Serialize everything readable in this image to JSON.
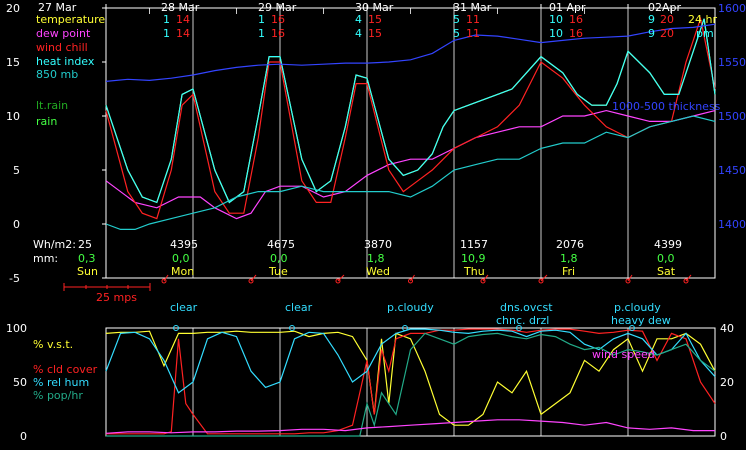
{
  "colors": {
    "temperature": "#ffff33",
    "dew_point": "#ff44ff",
    "wind_chill": "#ff2222",
    "heat_index": "#33ffff",
    "mb850": "#22cccc",
    "thickness": "#3344ff",
    "lt_rain": "#22aa22",
    "rain": "#44ff44",
    "vst": "#ffff33",
    "cld_cover": "#ff2222",
    "rel_hum": "#33ddff",
    "pop_hr": "#22aa88",
    "wind_speed": "#ff44ff",
    "grid": "#ffffff",
    "label_white": "#ffffff"
  },
  "dates": [
    "27 Mar",
    "28 Mar",
    "29 Mar",
    "30 Mar",
    "31 Mar",
    "01 Apr",
    "02Apr"
  ],
  "hour_labels": {
    "h24": "24 hr",
    "pm": "pm"
  },
  "daily_temps": [
    {
      "a": "1",
      "b": "14",
      "c": "1",
      "d": "14"
    },
    {
      "a": "1",
      "b": "16",
      "c": "1",
      "d": "16"
    },
    {
      "a": "4",
      "b": "15",
      "c": "4",
      "d": "15"
    },
    {
      "a": "5",
      "b": "11",
      "c": "5",
      "d": "11"
    },
    {
      "a": "10",
      "b": "16",
      "c": "10",
      "d": "16"
    },
    {
      "a": "9",
      "b": "20",
      "c": "9",
      "d": "20"
    }
  ],
  "legend_top": {
    "temperature": "temperature",
    "dew_point": "dew point",
    "wind_chill": "wind chill",
    "heat_index": "heat index",
    "mb850": "850 mb",
    "lt_rain": "lt.rain",
    "rain": "rain",
    "thickness": "1000-500 thickness"
  },
  "daily": {
    "wh_label": "Wh/m2:",
    "mm_label": "mm:",
    "first_wh": "25",
    "first_mm": "0,3",
    "first_day": "Sun",
    "days": [
      {
        "wh": "4395",
        "mm": "0,0",
        "day": "Mon"
      },
      {
        "wh": "4675",
        "mm": "0,0",
        "day": "Tue"
      },
      {
        "wh": "3870",
        "mm": "1,8",
        "day": "Wed"
      },
      {
        "wh": "1157",
        "mm": "10,9",
        "day": "Thu"
      },
      {
        "wh": "2076",
        "mm": "1,8",
        "day": "Fri"
      },
      {
        "wh": "4399",
        "mm": "0,0",
        "day": "Sat"
      }
    ]
  },
  "wind_scale": "25 mps",
  "sky": [
    {
      "l1": "clear",
      "l2": ""
    },
    {
      "l1": "clear",
      "l2": ""
    },
    {
      "l1": "p.cloudy",
      "l2": ""
    },
    {
      "l1": "dns.ovcst",
      "l2": "chnc. drzl"
    },
    {
      "l1": "p.cloudy",
      "l2": "heavy dew"
    }
  ],
  "legend_bottom": {
    "vst": "% v.s.t.",
    "cld_cover": "% cld cover",
    "rel_hum": "% rel hum",
    "pop_hr": "% pop/hr",
    "wind_speed": "wind speed"
  },
  "chart_data": [
    {
      "type": "line",
      "x_unit": "hours from 27 Mar 00:00",
      "xlim": [
        0,
        168
      ],
      "ylim_left": [
        -5,
        20
      ],
      "yticks_left": [
        "20",
        "15",
        "10",
        "5",
        "0",
        "-5"
      ],
      "ylim_right": [
        1350,
        1600
      ],
      "yticks_right": [
        "1600",
        "1550",
        "1500",
        "1450",
        "1400"
      ],
      "series": [
        {
          "name": "temperature",
          "axis": "left",
          "x": [
            0,
            6,
            10,
            14,
            18,
            21,
            24,
            30,
            34,
            38,
            42,
            45,
            48,
            54,
            58,
            62,
            66,
            69,
            72,
            78,
            82,
            86,
            90,
            93,
            96,
            100,
            104,
            108,
            112,
            116,
            120,
            126,
            130,
            134,
            138,
            141,
            144,
            150,
            154,
            158,
            162,
            165,
            168
          ],
          "y": [
            11,
            5,
            2.5,
            2,
            6,
            12,
            12.5,
            5,
            2,
            3,
            10,
            15.5,
            15.5,
            6,
            3,
            4,
            9,
            13.8,
            13.5,
            6,
            4.5,
            5,
            6.5,
            9,
            10.5,
            11,
            11.5,
            12,
            12.5,
            14,
            15.5,
            14,
            12,
            11,
            11,
            13,
            16,
            14,
            12,
            12,
            16,
            19,
            12
          ]
        },
        {
          "name": "dew point",
          "axis": "left",
          "x": [
            0,
            8,
            14,
            20,
            26,
            30,
            36,
            40,
            44,
            48,
            54,
            60,
            66,
            72,
            78,
            84,
            90,
            96,
            102,
            108,
            114,
            120,
            126,
            132,
            138,
            144,
            150,
            156,
            162,
            168
          ],
          "y": [
            4,
            2,
            1.5,
            2.5,
            2.5,
            1.5,
            0.5,
            1,
            3,
            3.5,
            3.5,
            2.5,
            3,
            4.5,
            5.5,
            6,
            6,
            7,
            8,
            8.5,
            9,
            9,
            10,
            10,
            10.5,
            10,
            9.5,
            9.5,
            10,
            10.5
          ]
        },
        {
          "name": "wind chill",
          "axis": "left",
          "x": [
            0,
            6,
            10,
            14,
            18,
            21,
            24,
            30,
            34,
            38,
            42,
            45,
            48,
            54,
            58,
            62,
            66,
            69,
            72,
            78,
            82,
            86,
            90,
            96,
            102,
            108,
            114,
            120,
            126,
            132,
            138,
            144,
            150,
            156,
            160,
            164,
            168
          ],
          "y": [
            10.5,
            3,
            1,
            0.5,
            5,
            11,
            12,
            3,
            1,
            1,
            8,
            15,
            15,
            4,
            2,
            2,
            8,
            13,
            13,
            5,
            3,
            4,
            5,
            7,
            8,
            9,
            11,
            15,
            13.5,
            11,
            9,
            8,
            9,
            9.5,
            15,
            19,
            12.5
          ]
        },
        {
          "name": "heat index",
          "axis": "left",
          "x": [
            0,
            6,
            10,
            14,
            18,
            21,
            24,
            30,
            34,
            38,
            42,
            45,
            48,
            54,
            58,
            62,
            66,
            69,
            72,
            78,
            82,
            86,
            90,
            93,
            96,
            100,
            104,
            108,
            112,
            116,
            120,
            126,
            130,
            134,
            138,
            141,
            144,
            150,
            154,
            158,
            162,
            165,
            168
          ],
          "y": [
            11,
            5,
            2.5,
            2,
            6,
            12,
            12.5,
            5,
            2,
            3,
            10,
            15.5,
            15.5,
            6,
            3,
            4,
            9,
            13.8,
            13.5,
            6,
            4.5,
            5,
            6.5,
            9,
            10.5,
            11,
            11.5,
            12,
            12.5,
            14,
            15.5,
            14,
            12,
            11,
            11,
            13,
            16,
            14,
            12,
            12,
            16,
            19,
            12
          ]
        },
        {
          "name": "850 mb",
          "axis": "left",
          "x": [
            0,
            4,
            8,
            12,
            18,
            24,
            30,
            36,
            42,
            48,
            54,
            60,
            66,
            72,
            78,
            84,
            90,
            96,
            102,
            108,
            114,
            120,
            126,
            132,
            138,
            144,
            150,
            156,
            162,
            168
          ],
          "y": [
            0,
            -0.5,
            -0.5,
            0,
            0.5,
            1,
            1.5,
            2.5,
            3,
            3,
            3.5,
            3,
            3,
            3,
            3,
            2.5,
            3.5,
            5,
            5.5,
            6,
            6,
            7,
            7.5,
            7.5,
            8.5,
            8,
            9,
            9.5,
            10,
            9.5
          ]
        },
        {
          "name": "1000-500 thickness",
          "axis": "right",
          "x": [
            0,
            6,
            12,
            18,
            24,
            30,
            36,
            42,
            48,
            54,
            60,
            66,
            72,
            78,
            84,
            90,
            96,
            102,
            108,
            114,
            120,
            126,
            132,
            138,
            144,
            150,
            156,
            162,
            168
          ],
          "y": [
            1532,
            1534,
            1533,
            1535,
            1538,
            1542,
            1545,
            1547,
            1548,
            1547,
            1548,
            1549,
            1549,
            1550,
            1552,
            1558,
            1570,
            1575,
            1574,
            1571,
            1568,
            1570,
            1572,
            1573,
            1574,
            1578,
            1581,
            1582,
            1585
          ]
        }
      ]
    },
    {
      "type": "line",
      "x_unit": "hours from 27 Mar 00:00",
      "xlim": [
        0,
        168
      ],
      "ylim_left": [
        0,
        100
      ],
      "yticks_left": [
        "100",
        "50",
        "0"
      ],
      "ylim_right": [
        0,
        40
      ],
      "yticks_right": [
        "40",
        "20",
        "0"
      ],
      "series": [
        {
          "name": "% v.s.t.",
          "axis": "left",
          "x": [
            0,
            4,
            8,
            12,
            16,
            20,
            24,
            28,
            32,
            36,
            40,
            44,
            48,
            52,
            56,
            60,
            64,
            68,
            72,
            74,
            76,
            78,
            80,
            84,
            88,
            92,
            96,
            100,
            104,
            108,
            112,
            116,
            120,
            124,
            128,
            132,
            136,
            140,
            144,
            148,
            152,
            156,
            160,
            164,
            168
          ],
          "y": [
            95,
            96,
            96,
            97,
            65,
            95,
            95,
            96,
            96,
            97,
            96,
            96,
            96,
            97,
            92,
            95,
            96,
            92,
            70,
            20,
            90,
            30,
            95,
            90,
            60,
            20,
            10,
            10,
            20,
            50,
            40,
            60,
            20,
            30,
            40,
            70,
            60,
            80,
            90,
            60,
            90,
            90,
            95,
            85,
            60
          ]
        },
        {
          "name": "% cld cover",
          "axis": "left",
          "x": [
            0,
            8,
            12,
            16,
            18,
            20,
            22,
            24,
            28,
            32,
            36,
            40,
            44,
            48,
            52,
            56,
            60,
            64,
            68,
            70,
            72,
            74,
            76,
            78,
            80,
            84,
            88,
            92,
            96,
            100,
            104,
            108,
            112,
            116,
            120,
            124,
            128,
            132,
            136,
            140,
            144,
            148,
            152,
            156,
            160,
            164,
            168
          ],
          "y": [
            2,
            2,
            2,
            2,
            4,
            90,
            30,
            20,
            2,
            2,
            2,
            2,
            2,
            2,
            2,
            3,
            3,
            5,
            10,
            40,
            70,
            20,
            80,
            60,
            90,
            95,
            95,
            98,
            98,
            99,
            99,
            99,
            98,
            96,
            98,
            99,
            99,
            97,
            95,
            96,
            98,
            97,
            70,
            95,
            90,
            50,
            30
          ]
        },
        {
          "name": "% rel hum",
          "axis": "left",
          "x": [
            0,
            4,
            8,
            12,
            16,
            20,
            24,
            28,
            32,
            36,
            40,
            44,
            48,
            52,
            56,
            60,
            64,
            68,
            72,
            76,
            80,
            84,
            88,
            92,
            96,
            100,
            104,
            108,
            112,
            116,
            120,
            124,
            128,
            132,
            136,
            140,
            144,
            148,
            152,
            156,
            160,
            164,
            168
          ],
          "y": [
            60,
            95,
            96,
            90,
            70,
            40,
            50,
            90,
            96,
            92,
            60,
            45,
            50,
            90,
            96,
            95,
            75,
            50,
            60,
            85,
            95,
            99,
            99,
            98,
            96,
            95,
            97,
            98,
            97,
            92,
            97,
            98,
            96,
            85,
            80,
            90,
            95,
            90,
            75,
            80,
            95,
            70,
            55
          ]
        },
        {
          "name": "% pop/hr",
          "axis": "left",
          "x": [
            0,
            12,
            24,
            36,
            48,
            60,
            70,
            72,
            74,
            76,
            80,
            84,
            88,
            92,
            96,
            100,
            104,
            108,
            112,
            116,
            120,
            124,
            128,
            132,
            136,
            140,
            144,
            148,
            152,
            156,
            160,
            164,
            168
          ],
          "y": [
            0,
            0,
            0,
            0,
            0,
            0,
            0,
            30,
            10,
            40,
            20,
            80,
            95,
            90,
            85,
            92,
            94,
            95,
            92,
            90,
            94,
            92,
            85,
            80,
            82,
            75,
            80,
            78,
            75,
            80,
            85,
            70,
            60
          ]
        },
        {
          "name": "wind speed",
          "axis": "right",
          "x": [
            0,
            6,
            12,
            18,
            24,
            30,
            36,
            42,
            48,
            54,
            60,
            66,
            72,
            78,
            84,
            90,
            96,
            102,
            108,
            114,
            120,
            126,
            132,
            138,
            144,
            150,
            156,
            162,
            168
          ],
          "y": [
            1,
            1.5,
            1.5,
            1.2,
            1.5,
            1.5,
            1.8,
            1.8,
            2,
            2.5,
            2.5,
            2,
            3,
            3.5,
            4,
            4.5,
            5,
            5.5,
            6,
            6,
            5.5,
            5,
            4,
            5,
            3,
            2.5,
            3,
            2,
            2
          ]
        }
      ]
    }
  ]
}
